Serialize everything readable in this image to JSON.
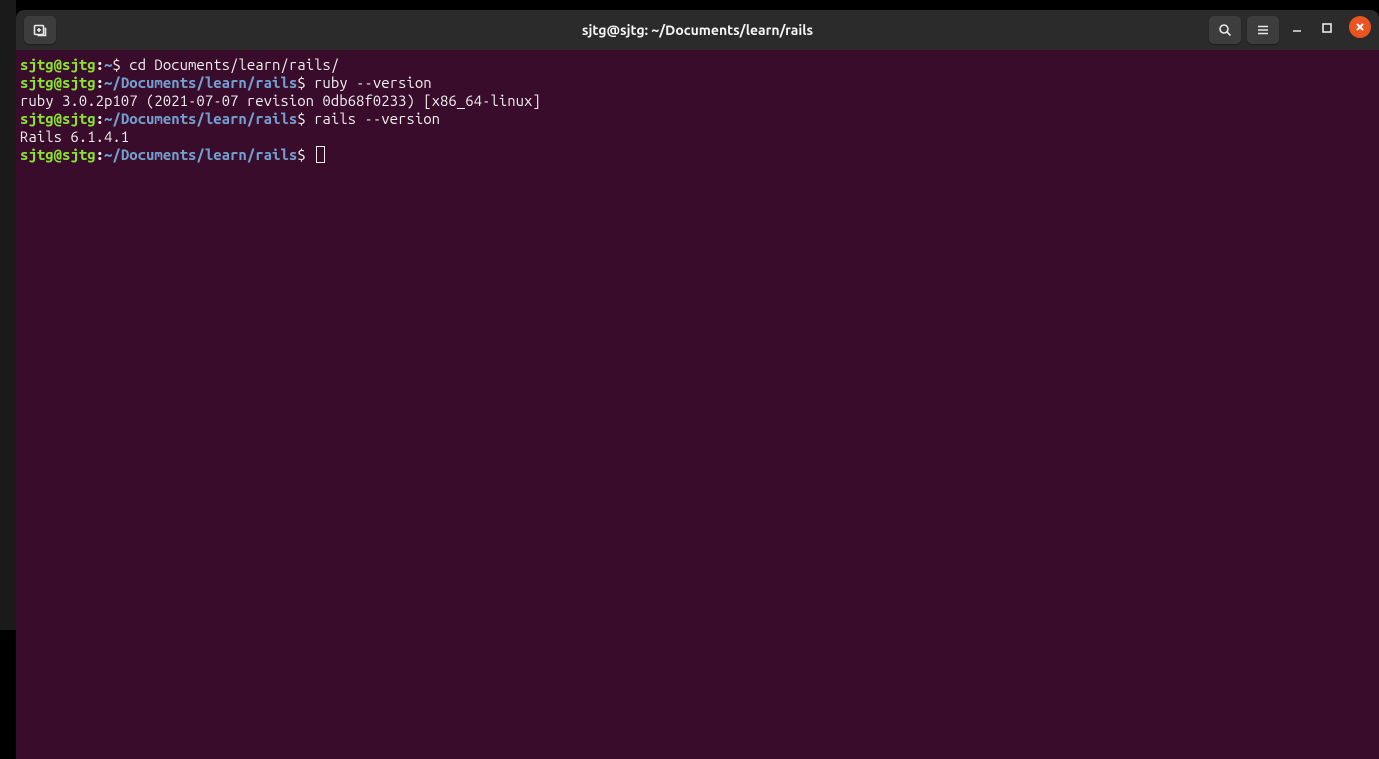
{
  "titlebar": {
    "title": "sjtg@sjtg: ~/Documents/learn/rails"
  },
  "prompt": {
    "user_host": "sjtg@sjtg",
    "separator": ":",
    "path_home": "~",
    "path_rails": "~/Documents/learn/rails",
    "symbol": "$"
  },
  "lines": [
    {
      "path": "~",
      "command": "cd Documents/learn/rails/"
    },
    {
      "path": "~/Documents/learn/rails",
      "command": "ruby --version"
    },
    {
      "output": "ruby 3.0.2p107 (2021-07-07 revision 0db68f0233) [x86_64-linux]"
    },
    {
      "path": "~/Documents/learn/rails",
      "command": "rails --version"
    },
    {
      "output": "Rails 6.1.4.1"
    },
    {
      "path": "~/Documents/learn/rails",
      "command": "",
      "cursor": true
    }
  ]
}
